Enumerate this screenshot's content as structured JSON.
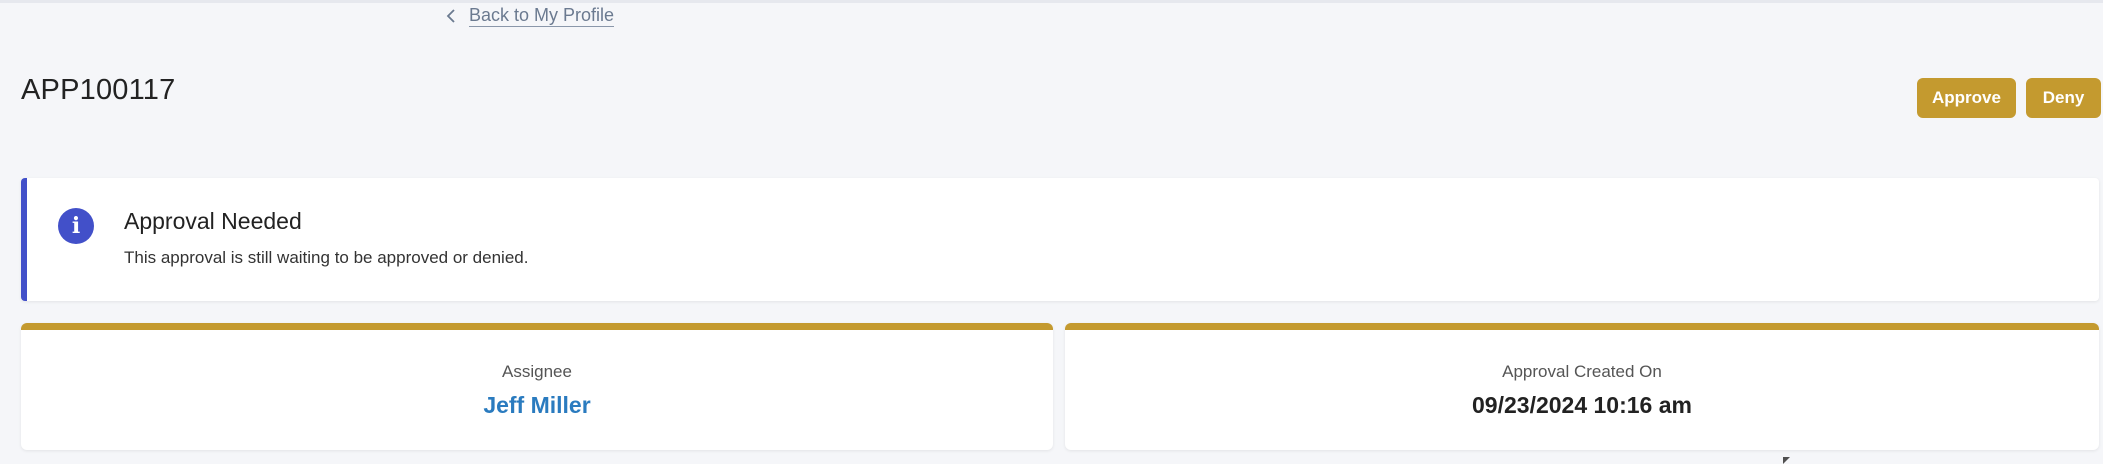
{
  "nav": {
    "back_label": "Back to My Profile",
    "back_icon": "chevron-left-icon"
  },
  "header": {
    "title": "APP100117",
    "approve_label": "Approve",
    "deny_label": "Deny"
  },
  "alert": {
    "icon": "info-icon",
    "icon_glyph": "i",
    "title": "Approval Needed",
    "message": "This approval is still waiting to be approved or denied."
  },
  "cards": {
    "assignee": {
      "label": "Assignee",
      "value": "Jeff Miller"
    },
    "created": {
      "label": "Approval Created On",
      "value": "09/23/2024 10:16 am"
    }
  },
  "colors": {
    "accent": "#c49a2f",
    "info": "#4250c9",
    "link": "#2a7bbf",
    "background": "#f5f6f9"
  }
}
